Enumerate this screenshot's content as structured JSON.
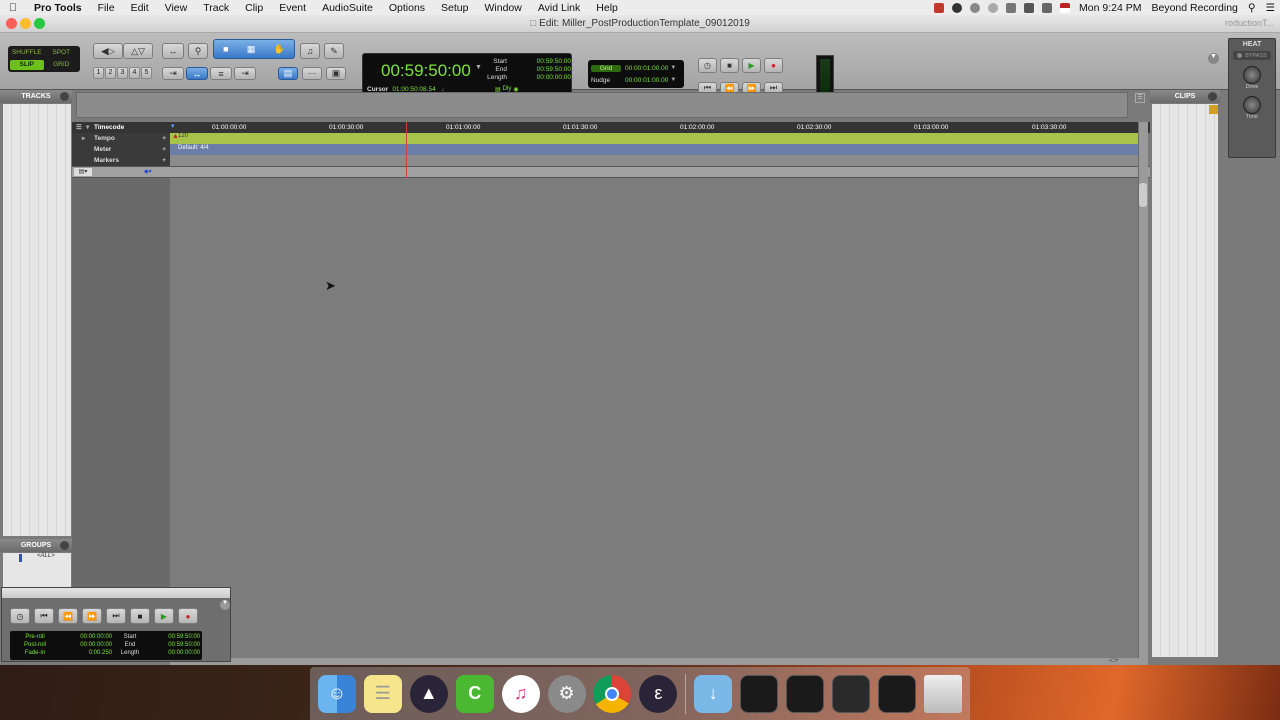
{
  "menubar": {
    "app": "Pro Tools",
    "items": [
      "File",
      "Edit",
      "View",
      "Track",
      "Clip",
      "Event",
      "AudioSuite",
      "Options",
      "Setup",
      "Window",
      "Avid Link",
      "Help"
    ],
    "clock": "Mon 9:24 PM",
    "user": "Beyond Recording"
  },
  "window": {
    "title": "Edit: Miller_PostProductionTemplate_09012019",
    "title_right": "roductionT..."
  },
  "edit_modes": {
    "shuffle": "SHUFFLE",
    "spot": "SPOT",
    "slip": "SLIP",
    "grid": "GRID"
  },
  "zoom_presets": [
    "1",
    "2",
    "3",
    "4",
    "5"
  ],
  "counter": {
    "main": "00:59:50:00",
    "start_label": "Start",
    "start": "00:59:50:00",
    "end_label": "End",
    "end": "00:59:50:00",
    "length_label": "Length",
    "length": "00:00:00:00",
    "cursor_label": "Cursor",
    "cursor": "01:00:50:08.54",
    "dly": "Dly"
  },
  "grid_nudge": {
    "grid_label": "Grid",
    "grid_value": "00:00:01:00.00",
    "nudge_label": "Nudge",
    "nudge_value": "00:00:01:00.00"
  },
  "heat": {
    "title": "HEAT",
    "bypass": "BYPASS",
    "drive": "Drive",
    "tone": "Tone"
  },
  "panels": {
    "tracks": "TRACKS",
    "clips": "CLIPS",
    "groups": "GROUPS",
    "groups_all": "<ALL>"
  },
  "rulers": {
    "timecode": "Timecode",
    "tempo": "Tempo",
    "meter": "Meter",
    "markers": "Markers",
    "tempo_value": "120",
    "meter_value": "Default: 4/4",
    "ticks": [
      "01:00:00:00",
      "01:00:30:00",
      "01:01:00:00",
      "01:01:30:00",
      "01:02:00:00",
      "01:02:30:00",
      "01:03:00:00",
      "01:03:30:00"
    ]
  },
  "transport_window": {
    "preroll_label": "Pre-roll",
    "preroll": "00:00:00:00",
    "postroll_label": "Post-roll",
    "postroll": "00:00:00:00",
    "fadein_label": "Fade-in",
    "fadein": "0:00.250",
    "start_label": "Start",
    "start": "00:59:50:00",
    "end_label": "End",
    "end": "00:59:50:00",
    "length_label": "Length",
    "length": "00:00:00:00"
  },
  "dock": [
    "finder-icon",
    "notes-icon",
    "pro-tools-icon",
    "camtasia-icon",
    "itunes-icon",
    "system-preferences-icon",
    "chrome-icon",
    "eleven-icon",
    "downloads-folder-icon",
    "trash-icon"
  ]
}
